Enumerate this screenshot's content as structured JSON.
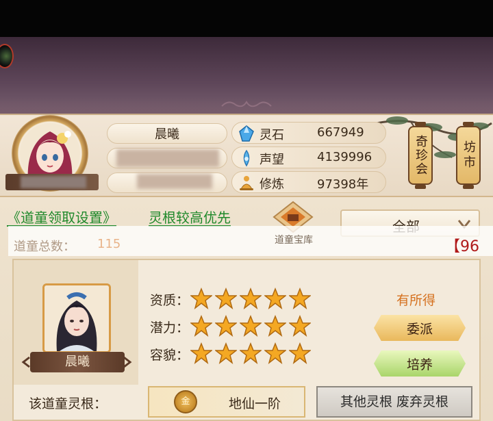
{
  "player": {
    "name": "晨曦"
  },
  "resources": [
    {
      "icon": "spirit-stone-icon",
      "label": "灵石",
      "value": "667949"
    },
    {
      "icon": "reputation-icon",
      "label": "声望",
      "value": "4139996"
    },
    {
      "icon": "cultivation-icon",
      "label": "修炼",
      "value": "97398年"
    }
  ],
  "side_buttons": {
    "treasure_fair": "奇珍会",
    "market": "坊市"
  },
  "toolbar": {
    "collect_settings_link": "《道童领取设置》",
    "priority_link": "灵根较高优先",
    "vault_label": "道童宝库",
    "filter_value": "全部"
  },
  "summary": {
    "total_label": "道童总数：",
    "total_value": "115",
    "right_partial": "【96"
  },
  "disciple": {
    "name": "晨曦",
    "attributes": [
      {
        "label": "资质：",
        "stars": 5
      },
      {
        "label": "潜力：",
        "stars": 5
      },
      {
        "label": "容貌：",
        "stars": 5
      }
    ],
    "status": "有所得",
    "assign_button": "委派",
    "train_button": "培养",
    "root_label": "该道童灵根：",
    "root_badge": "金",
    "root_value": "地仙一阶",
    "other_roots_button": "其他灵根 废弃灵根"
  },
  "colors": {
    "link_green": "#20892b",
    "status_orange": "#d5711f",
    "star_gold": "#f4a823",
    "count_red": "#b01a1a"
  }
}
